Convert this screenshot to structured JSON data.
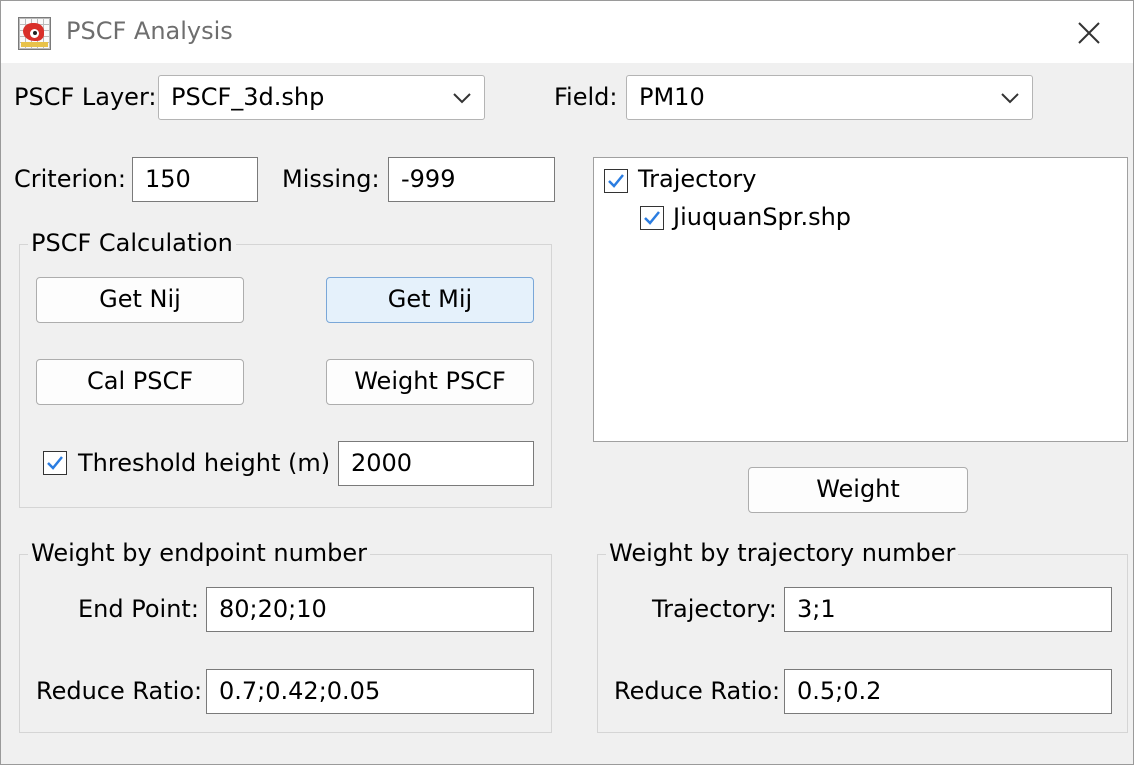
{
  "window": {
    "title": "PSCF Analysis"
  },
  "top": {
    "layer_label": "PSCF Layer:",
    "layer_value": "PSCF_3d.shp",
    "field_label": "Field:",
    "field_value": "PM10"
  },
  "params": {
    "criterion_label": "Criterion:",
    "criterion_value": "150",
    "missing_label": "Missing:",
    "missing_value": "-999"
  },
  "calc": {
    "title": "PSCF Calculation",
    "get_nij": "Get Nij",
    "get_mij": "Get Mij",
    "cal_pscf": "Cal PSCF",
    "weight_pscf": "Weight PSCF",
    "threshold_label": "Threshold height (m)",
    "threshold_checked": true,
    "threshold_value": "2000"
  },
  "tree": {
    "root_label": "Trajectory",
    "root_checked": true,
    "child_label": "JiuquanSpr.shp",
    "child_checked": true
  },
  "weight_button": "Weight",
  "endpoint_group": {
    "title": "Weight by endpoint number",
    "end_point_label": "End Point:",
    "end_point_value": "80;20;10",
    "reduce_label": "Reduce Ratio:",
    "reduce_value": "0.7;0.42;0.05"
  },
  "trajectory_group": {
    "title": "Weight by trajectory number",
    "trajectory_label": "Trajectory:",
    "trajectory_value": "3;1",
    "reduce_label": "Reduce Ratio:",
    "reduce_value": "0.5;0.2"
  },
  "colors": {
    "check_mark": "#2b7de1",
    "focused_button_bg": "#e5f1fb",
    "focused_button_border": "#7aa7d8"
  }
}
